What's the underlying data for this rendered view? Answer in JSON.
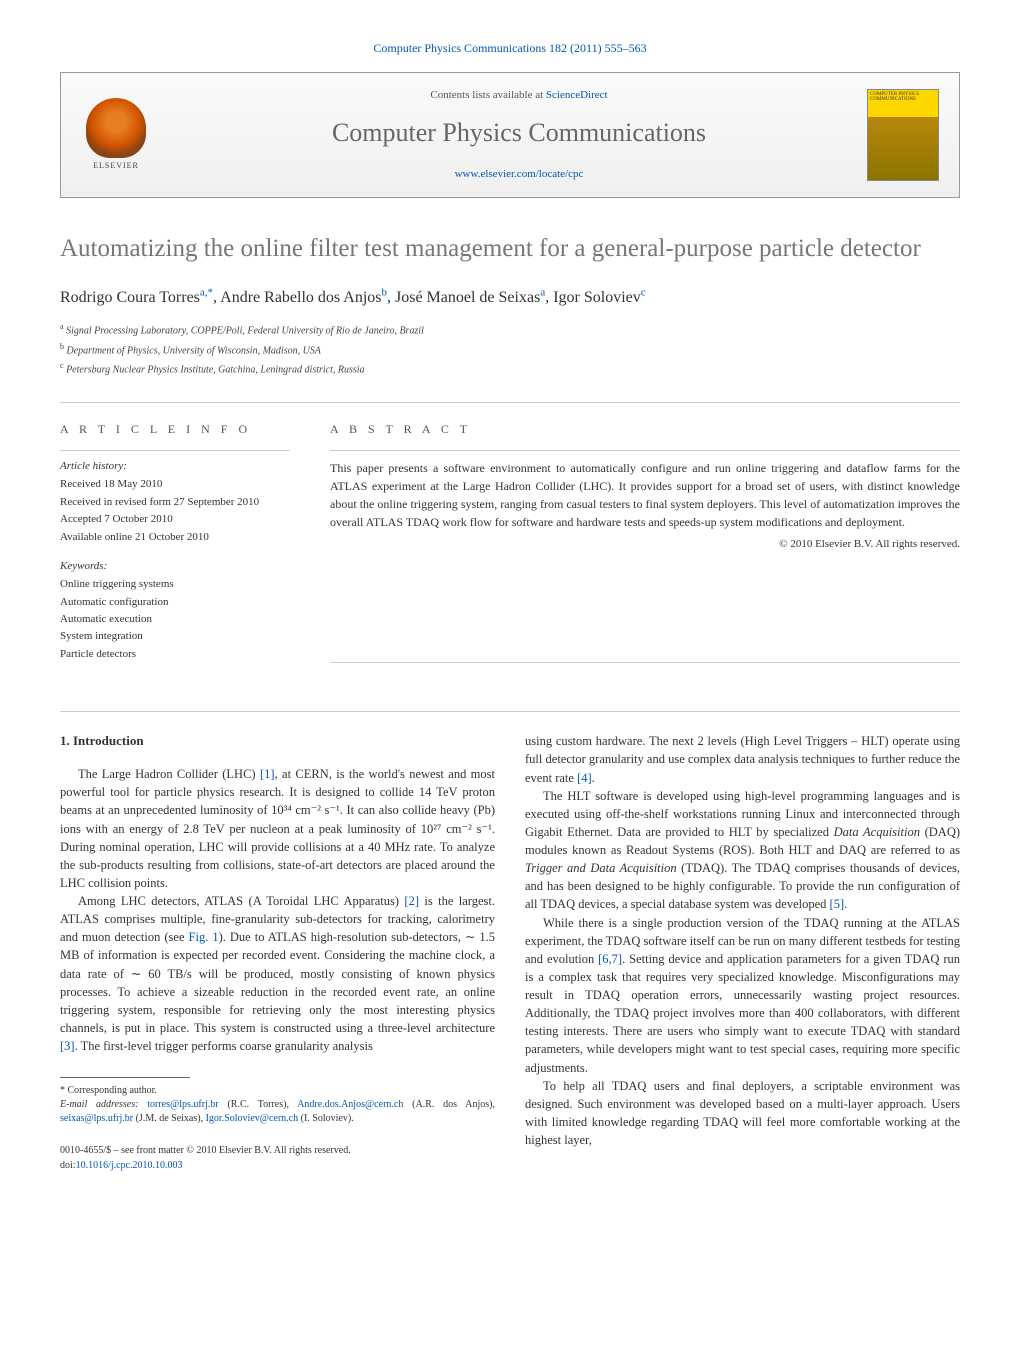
{
  "citation": "Computer Physics Communications 182 (2011) 555–563",
  "header": {
    "contents_prefix": "Contents lists available at ",
    "contents_link": "ScienceDirect",
    "journal_name": "Computer Physics Communications",
    "journal_url": "www.elsevier.com/locate/cpc",
    "publisher_name": "ELSEVIER",
    "cover_text": "COMPUTER PHYSICS COMMUNICATIONS"
  },
  "title": "Automatizing the online filter test management for a general-purpose particle detector",
  "authors": [
    {
      "name": "Rodrigo Coura Torres",
      "affil": "a,",
      "corr": "*"
    },
    {
      "name": "Andre Rabello dos Anjos",
      "affil": "b",
      "corr": ""
    },
    {
      "name": "José Manoel de Seixas",
      "affil": "a",
      "corr": ""
    },
    {
      "name": "Igor Soloviev",
      "affil": "c",
      "corr": ""
    }
  ],
  "affiliations": [
    {
      "sup": "a",
      "text": "Signal Processing Laboratory, COPPE/Poli, Federal University of Rio de Janeiro, Brazil"
    },
    {
      "sup": "b",
      "text": "Department of Physics, University of Wisconsin, Madison, USA"
    },
    {
      "sup": "c",
      "text": "Petersburg Nuclear Physics Institute, Gatchina, Leningrad district, Russia"
    }
  ],
  "article_info": {
    "heading": "A R T I C L E   I N F O",
    "history_label": "Article history:",
    "history": [
      "Received 18 May 2010",
      "Received in revised form 27 September 2010",
      "Accepted 7 October 2010",
      "Available online 21 October 2010"
    ],
    "keywords_label": "Keywords:",
    "keywords": [
      "Online triggering systems",
      "Automatic configuration",
      "Automatic execution",
      "System integration",
      "Particle detectors"
    ]
  },
  "abstract": {
    "heading": "A B S T R A C T",
    "text": "This paper presents a software environment to automatically configure and run online triggering and dataflow farms for the ATLAS experiment at the Large Hadron Collider (LHC). It provides support for a broad set of users, with distinct knowledge about the online triggering system, ranging from casual testers to final system deployers. This level of automatization improves the overall ATLAS TDAQ work flow for software and hardware tests and speeds-up system modifications and deployment.",
    "copyright": "© 2010 Elsevier B.V. All rights reserved."
  },
  "body": {
    "section_heading": "1. Introduction",
    "left_col": {
      "p1_a": "The Large Hadron Collider (LHC) ",
      "p1_ref1": "[1]",
      "p1_b": ", at CERN, is the world's newest and most powerful tool for particle physics research. It is designed to collide 14 TeV proton beams at an unprecedented luminosity of 10³⁴ cm⁻² s⁻¹. It can also collide heavy (Pb) ions with an energy of 2.8 TeV per nucleon at a peak luminosity of 10²⁷ cm⁻² s⁻¹. During nominal operation, LHC will provide collisions at a 40 MHz rate. To analyze the sub-products resulting from collisions, state-of-art detectors are placed around the LHC collision points.",
      "p2_a": "Among LHC detectors, ATLAS (A Toroidal LHC Apparatus) ",
      "p2_ref2": "[2]",
      "p2_b": " is the largest. ATLAS comprises multiple, fine-granularity sub-detectors for tracking, calorimetry and muon detection (see ",
      "p2_fig1": "Fig. 1",
      "p2_c": "). Due to ATLAS high-resolution sub-detectors, ∼ 1.5 MB of information is expected per recorded event. Considering the machine clock, a data rate of ∼ 60 TB/s will be produced, mostly consisting of known physics processes. To achieve a sizeable reduction in the recorded event rate, an online triggering system, responsible for retrieving only the most interesting physics channels, is put in place. This system is constructed using a three-level architecture ",
      "p2_ref3": "[3]",
      "p2_d": ". The first-level trigger performs coarse granularity analysis"
    },
    "right_col": {
      "p1_a": "using custom hardware. The next 2 levels (High Level Triggers – HLT) operate using full detector granularity and use complex data analysis techniques to further reduce the event rate ",
      "p1_ref4": "[4]",
      "p1_b": ".",
      "p2_a": "The HLT software is developed using high-level programming languages and is executed using off-the-shelf workstations running Linux and interconnected through Gigabit Ethernet. Data are provided to HLT by specialized ",
      "p2_i1": "Data Acquisition",
      "p2_b": " (DAQ) modules known as Readout Systems (ROS). Both HLT and DAQ are referred to as ",
      "p2_i2": "Trigger and Data Acquisition",
      "p2_c": " (TDAQ). The TDAQ comprises thousands of devices, and has been designed to be highly configurable. To provide the run configuration of all TDAQ devices, a special database system was developed ",
      "p2_ref5": "[5]",
      "p2_d": ".",
      "p3_a": "While there is a single production version of the TDAQ running at the ATLAS experiment, the TDAQ software itself can be run on many different testbeds for testing and evolution ",
      "p3_ref67": "[6,7]",
      "p3_b": ". Setting device and application parameters for a given TDAQ run is a complex task that requires very specialized knowledge. Misconfigurations may result in TDAQ operation errors, unnecessarily wasting project resources. Additionally, the TDAQ project involves more than 400 collaborators, with different testing interests. There are users who simply want to execute TDAQ with standard parameters, while developers might want to test special cases, requiring more specific adjustments.",
      "p4": "To help all TDAQ users and final deployers, a scriptable environment was designed. Such environment was developed based on a multi-layer approach. Users with limited knowledge regarding TDAQ will feel more comfortable working at the highest layer,"
    }
  },
  "footnote": {
    "corr_label": "* Corresponding author.",
    "email_label": "E-mail addresses:",
    "emails": [
      {
        "addr": "torres@lps.ufrj.br",
        "who": "(R.C. Torres)"
      },
      {
        "addr": "Andre.dos.Anjos@cern.ch",
        "who": "(A.R. dos Anjos)"
      },
      {
        "addr": "seixas@lps.ufrj.br",
        "who": "(J.M. de Seixas)"
      },
      {
        "addr": "Igor.Soloviev@cern.ch",
        "who": "(I. Soloviev)."
      }
    ]
  },
  "bottom": {
    "issn": "0010-4655/$ – see front matter © 2010 Elsevier B.V. All rights reserved.",
    "doi_label": "doi:",
    "doi": "10.1016/j.cpc.2010.10.003"
  }
}
